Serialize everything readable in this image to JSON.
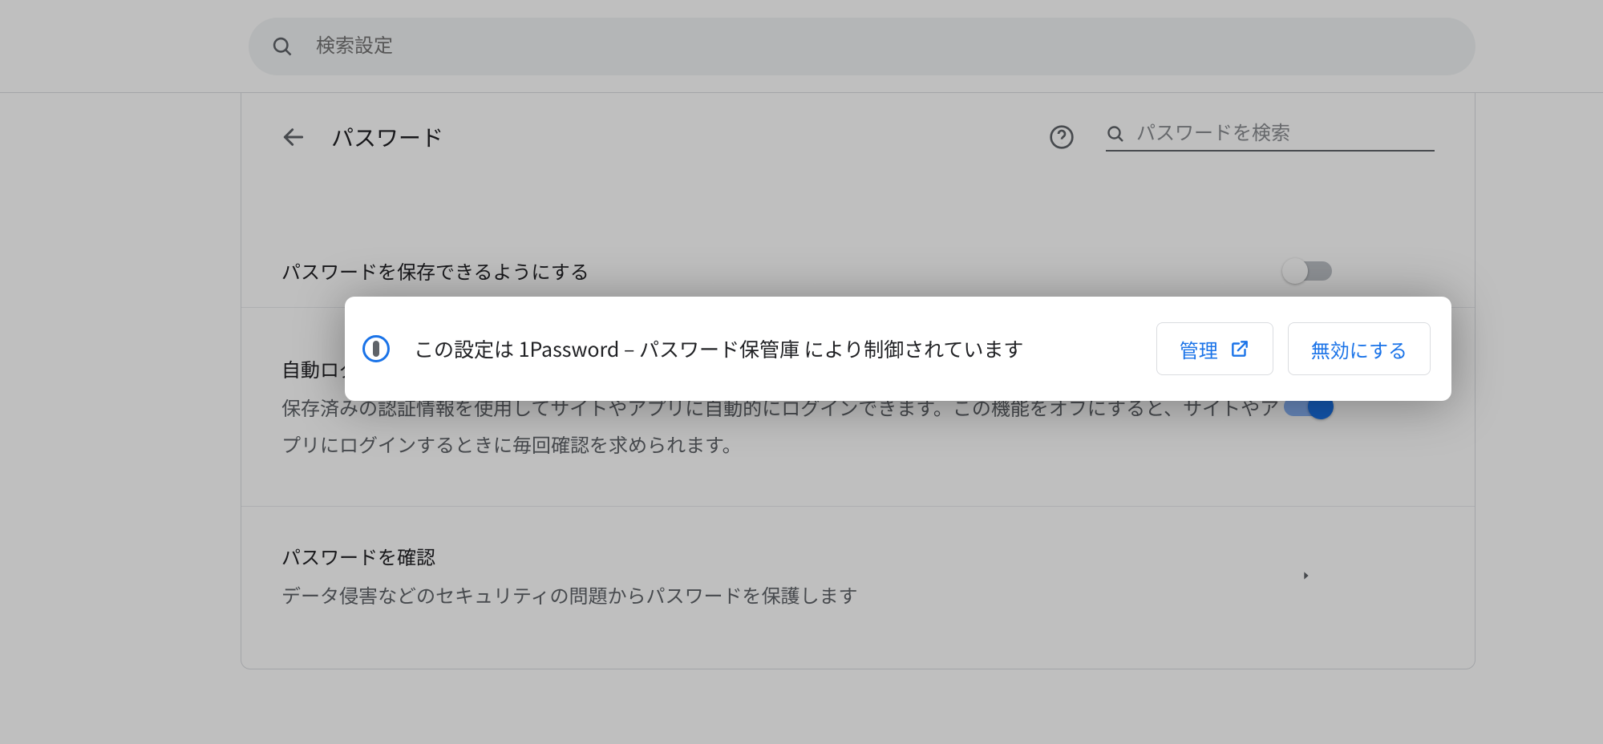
{
  "top_search": {
    "placeholder": "検索設定"
  },
  "header": {
    "title": "パスワード",
    "password_search_placeholder": "パスワードを検索"
  },
  "rows": {
    "save_passwords": {
      "title": "パスワードを保存できるようにする",
      "toggle_on": false
    },
    "auto_login": {
      "title": "自動ログイン",
      "desc": "保存済みの認証情報を使用してサイトやアプリに自動的にログインできます。この機能をオフにすると、サイトやアプリにログインするときに毎回確認を求められます。",
      "toggle_on": true
    },
    "check_passwords": {
      "title": "パスワードを確認",
      "desc": "データ侵害などのセキュリティの問題からパスワードを保護します"
    }
  },
  "notice": {
    "text": "この設定は 1Password – パスワード保管庫 により制御されています",
    "manage_label": "管理",
    "disable_label": "無効にする"
  }
}
